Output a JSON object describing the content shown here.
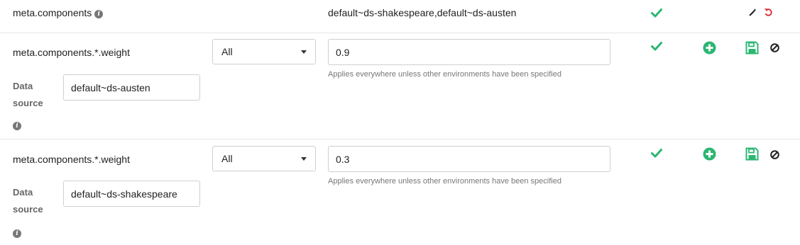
{
  "rows": [
    {
      "key": "meta.components",
      "value": "default~ds-shakespeare,default~ds-austen",
      "icons": [
        "info-icon",
        "check-icon",
        "pencil-icon",
        "undo-icon"
      ]
    },
    {
      "key": "meta.components.*.weight",
      "environment": "All",
      "value": "0.9",
      "help": "Applies everywhere unless other environments have been specified",
      "datasource_label_line1": "Data",
      "datasource_label_line2": "source",
      "datasource": "default~ds-austen",
      "icons": [
        "check-icon",
        "add-icon",
        "save-icon",
        "cancel-icon",
        "info-icon"
      ]
    },
    {
      "key": "meta.components.*.weight",
      "environment": "All",
      "value": "0.3",
      "help": "Applies everywhere unless other environments have been specified",
      "datasource_label_line1": "Data",
      "datasource_label_line2": "source",
      "datasource": "default~ds-shakespeare",
      "icons": [
        "check-icon",
        "add-icon",
        "save-icon",
        "cancel-icon",
        "info-icon"
      ]
    }
  ],
  "colors": {
    "green": "#2bb673",
    "red": "#d9262e",
    "icon_dark": "#222222",
    "border": "#cfcfcf"
  }
}
